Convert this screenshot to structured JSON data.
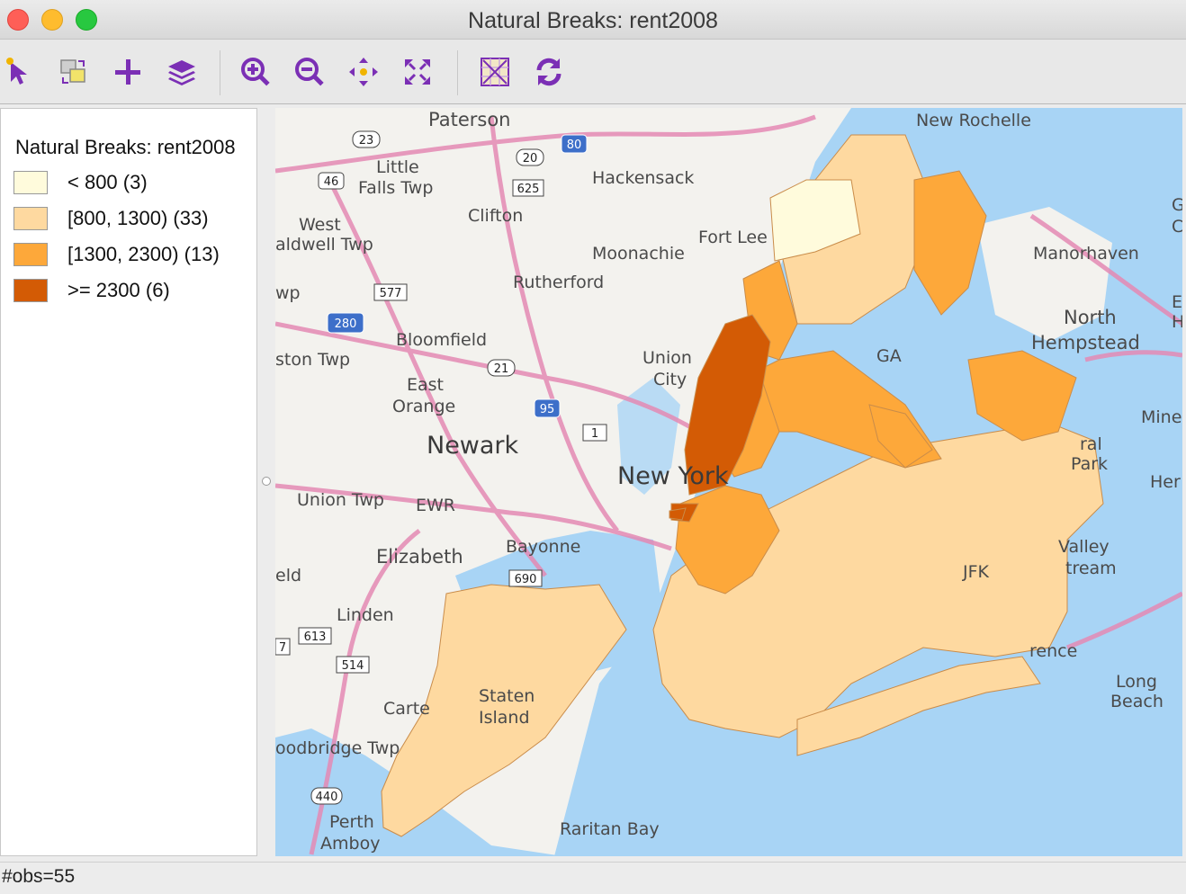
{
  "window": {
    "title": "Natural Breaks: rent2008"
  },
  "toolbar": {
    "tools": [
      {
        "name": "select-tool-icon"
      },
      {
        "name": "selection-mode-icon"
      },
      {
        "name": "add-icon"
      },
      {
        "name": "layers-icon"
      },
      {
        "name": "zoom-in-icon"
      },
      {
        "name": "zoom-out-icon"
      },
      {
        "name": "pan-icon"
      },
      {
        "name": "full-extent-icon"
      },
      {
        "name": "basemap-icon"
      },
      {
        "name": "refresh-icon"
      }
    ],
    "icon_color": "#7b2fb5"
  },
  "legend": {
    "title": "Natural Breaks: rent2008",
    "items": [
      {
        "label": "< 800 (3)",
        "color": "#fffbdc"
      },
      {
        "label": "[800, 1300) (33)",
        "color": "#fed9a0"
      },
      {
        "label": "[1300, 2300) (13)",
        "color": "#fda83a"
      },
      {
        "label": ">= 2300 (6)",
        "color": "#d35b05"
      }
    ]
  },
  "map": {
    "place_labels": {
      "paterson": "Paterson",
      "new_rochelle": "New Rochelle",
      "little_falls": "Little",
      "little_falls2": "Falls Twp",
      "hackensack": "Hackensack",
      "west_caldwell": "West",
      "west_caldwell2": "aldwell Twp",
      "clifton": "Clifton",
      "fort_lee": "Fort Lee",
      "moonachie": "Moonachie",
      "manorhaven": "Manorhaven",
      "rutherford": "Rutherford",
      "north_hempstead": "North",
      "north_hempstead2": "Hempstead",
      "bloomfield": "Bloomfield",
      "livingston": "ston Twp",
      "union_city": "Union",
      "union_city2": "City",
      "east_orange": "East",
      "east_orange2": "Orange",
      "newark": "Newark",
      "new_york": "New York",
      "union_twp": "Union Twp",
      "ewr": "EWR",
      "floral_park": "ral",
      "floral_park2": "Park",
      "mineola": "Mine",
      "her": "Her",
      "elizabeth": "Elizabeth",
      "bayonne": "Bayonne",
      "valley_stream": "Valley",
      "valley_stream2": "tream",
      "linden": "Linden",
      "lawrence": "rence",
      "long_beach": "Long",
      "long_beach2": "Beach",
      "carteret": "Carte",
      "staten_island": "Staten",
      "staten_island2": "Island",
      "woodbridge": "oodbridge Twp",
      "perth_amboy": "Perth",
      "perth_amboy2": "Amboy",
      "raritan_bay": "Raritan Bay",
      "eld": "eld",
      "wp": "wp",
      "ga": "GA",
      "jfk": "JFK",
      "e": "E",
      "h": "H",
      "g": "G",
      "c": "C"
    },
    "route_shields": [
      "23",
      "80",
      "20",
      "46",
      "625",
      "577",
      "280",
      "21",
      "95",
      "1",
      "690",
      "613",
      "514",
      "440",
      "7"
    ],
    "water_color": "#a8d4f5",
    "land_color": "#f3f2ee",
    "highway_color": "#e48ab4"
  },
  "status": {
    "text": "#obs=55"
  }
}
